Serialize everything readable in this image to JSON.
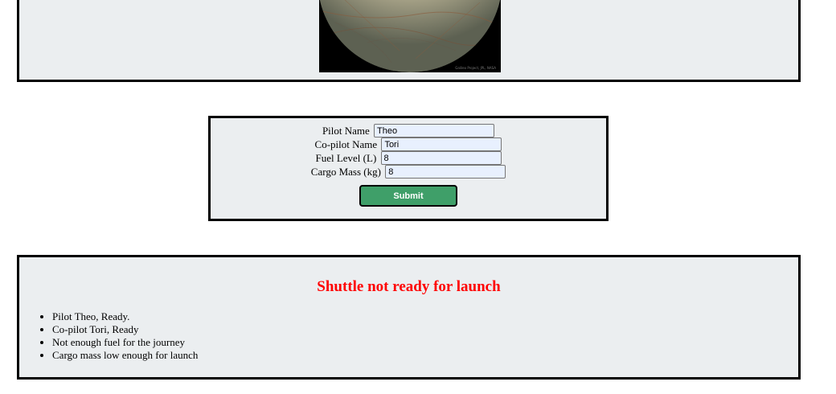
{
  "image": {
    "alt": "Europa moon",
    "credit": "Galileo Project, JPL, NASA"
  },
  "form": {
    "fields": [
      {
        "label": "Pilot Name",
        "value": "Theo"
      },
      {
        "label": "Co-pilot Name",
        "value": "Tori"
      },
      {
        "label": "Fuel Level (L)",
        "value": "8"
      },
      {
        "label": "Cargo Mass (kg)",
        "value": "8"
      }
    ],
    "submit_label": "Submit",
    "submit_color": "#3f9f69"
  },
  "status": {
    "heading": "Shuttle not ready for launch",
    "heading_color": "#ff0000",
    "items": [
      "Pilot Theo, Ready.",
      "Co-pilot Tori, Ready",
      "Not enough fuel for the journey",
      "Cargo mass low enough for launch"
    ]
  },
  "colors": {
    "panel_bg": "#ebeef0",
    "border": "#000000"
  }
}
